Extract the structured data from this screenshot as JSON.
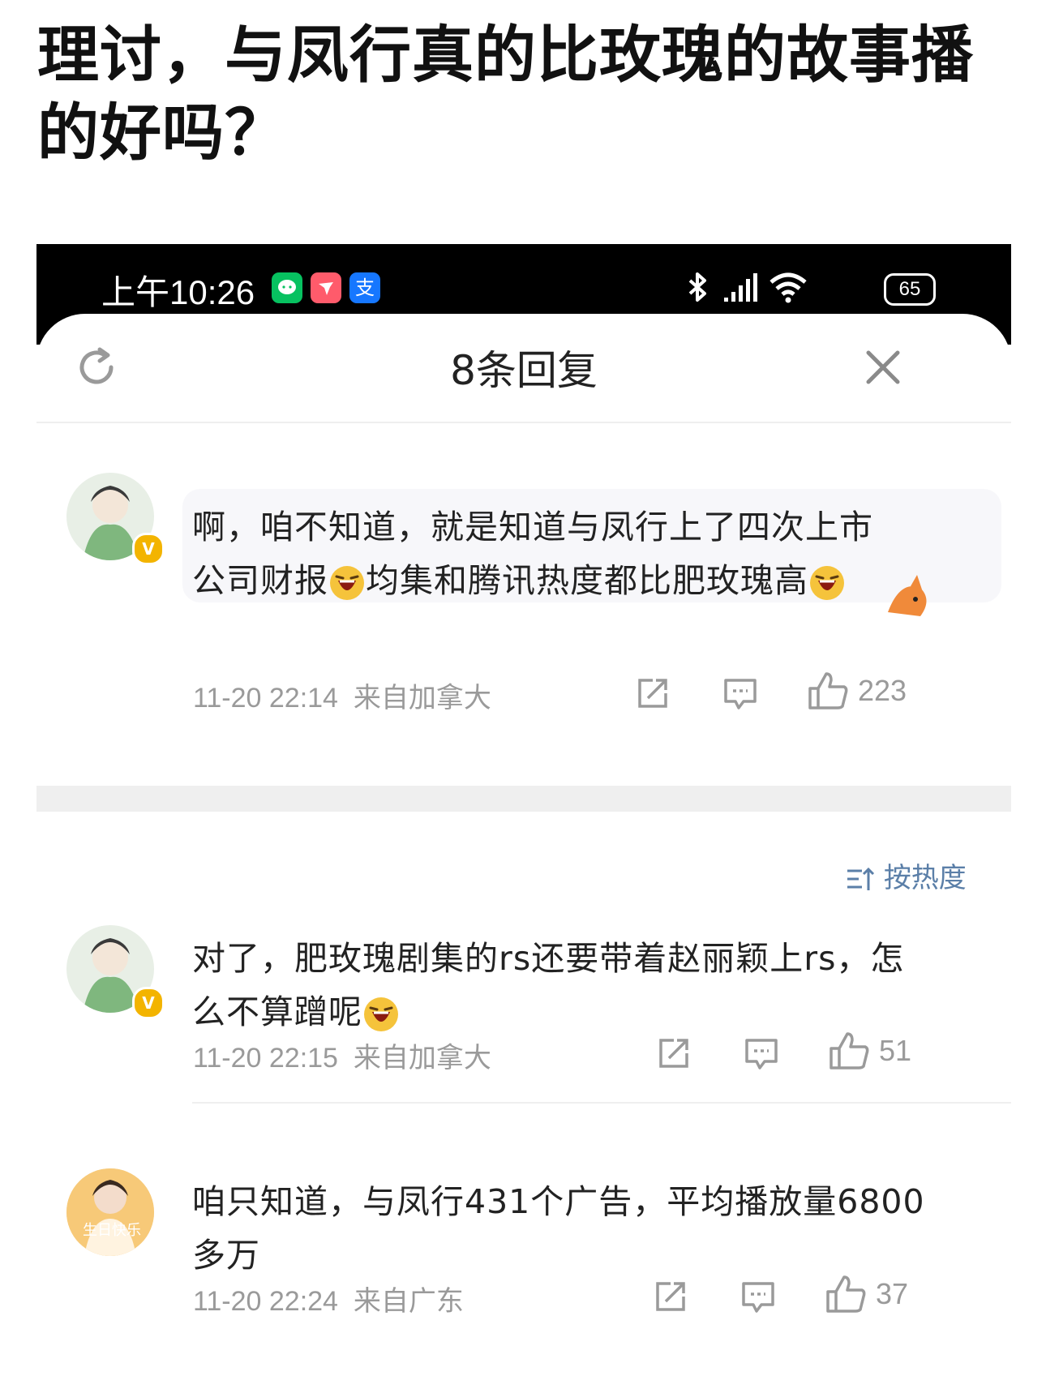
{
  "headline": "理讨，与凤行真的比玫瑰的故事播的好吗？",
  "status_bar": {
    "time": "上午10:26",
    "battery": "65",
    "app_icons": [
      "wechat-icon",
      "app-icon",
      "alipay-icon"
    ],
    "system_icons": [
      "bluetooth-icon",
      "signal-icon",
      "wifi-icon"
    ]
  },
  "sheet": {
    "title": "8条回复",
    "refresh_icon": "refresh-icon",
    "close_icon": "close-icon"
  },
  "sort_label": "按热度",
  "comments": [
    {
      "text_line1": "啊，咱不知道，就是知道与凤行上了四次上市",
      "text_line2a": "公司财报",
      "text_line2b": "均集和腾讯热度都比肥玫瑰高",
      "time": "11-20 22:14",
      "location": "来自加拿大",
      "likes": "223"
    },
    {
      "text_line1": "对了，肥玫瑰剧集的rs还要带着赵丽颖上rs，怎",
      "text_line2": "么不算蹭呢",
      "time": "11-20 22:15",
      "location": "来自加拿大",
      "likes": "51"
    },
    {
      "text_line1": "咱只知道，与凤行431个广告，平均播放量6800",
      "text_line2": "多万",
      "time": "11-20 22:24",
      "location": "来自广东",
      "likes": "37"
    }
  ],
  "colors": {
    "verified_badge": "#f3b400",
    "sort_text": "#5b7fa8",
    "meta_text": "#9a9a9a"
  }
}
